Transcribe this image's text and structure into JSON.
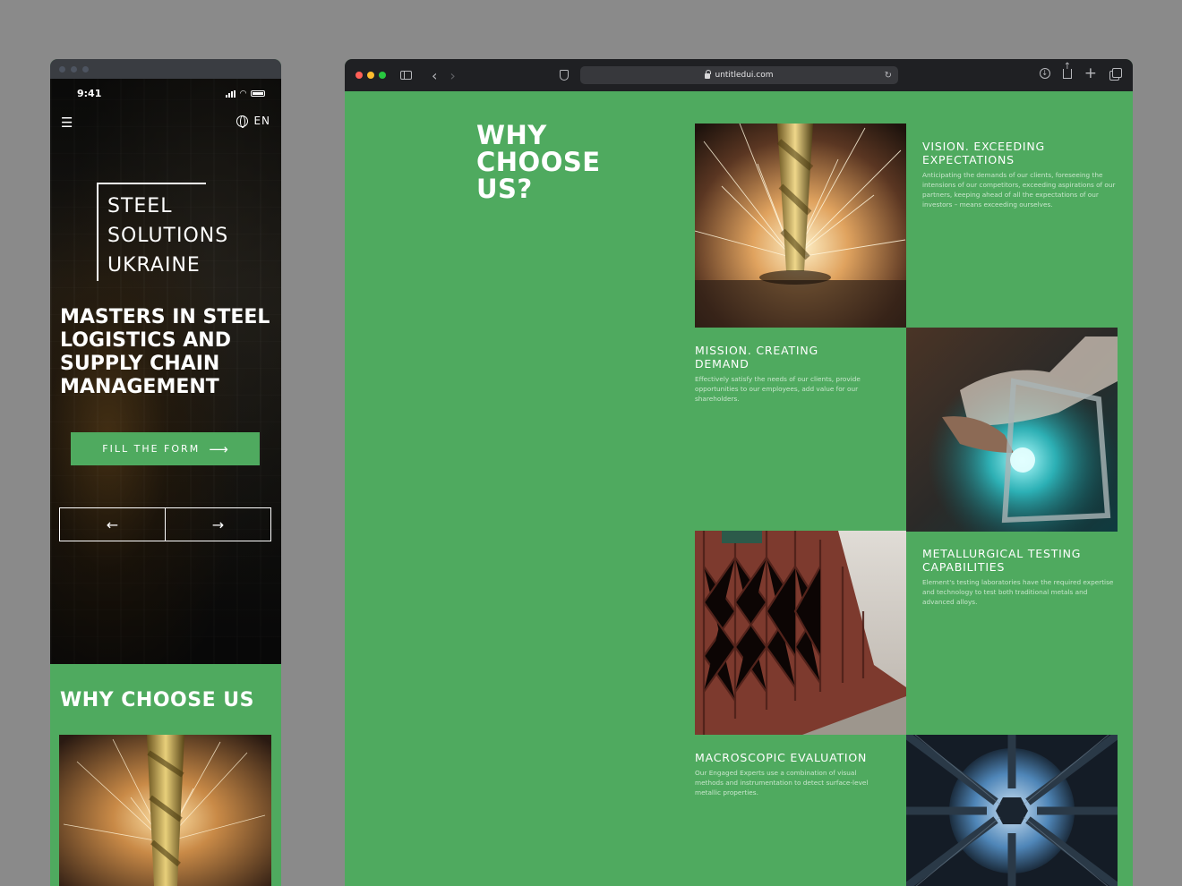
{
  "mobile": {
    "status": {
      "time": "9:41"
    },
    "lang": "EN",
    "logo_lines": [
      "STEEL",
      "SOLUTIONS",
      "UKRAINE"
    ],
    "headline": "MASTERS IN STEEL LOGISTICS AND SUPPLY CHAIN MANAGEMENT",
    "cta_label": "FILL THE FORM",
    "prev_arrow": "←",
    "next_arrow": "→",
    "section_title": "WHY CHOOSE US",
    "menu_icon": "☰"
  },
  "browser": {
    "url": "untitledui.com",
    "traffic_colors": [
      "#ff5f57",
      "#febc2e",
      "#28c840"
    ],
    "section_title": "WHY CHOOSE US?",
    "tiles": [
      {
        "title": "VISION. EXCEEDING EXPECTATIONS",
        "text": "Anticipating the demands of our clients, foreseeing the intensions of our competitors, exceeding aspirations of our partners, keeping ahead of all the expectations of our investors – means exceeding ourselves."
      },
      {
        "title": "MISSION. CREATING DEMAND",
        "text": "Effectively satisfy the needs of our clients, provide opportunities to our employees, add value for our shareholders."
      },
      {
        "title": "METALLURGICAL TESTING CAPABILITIES",
        "text": "Element's testing laboratories have the required expertise and technology to test both traditional metals and advanced alloys."
      },
      {
        "title": "MACROSCOPIC EVALUATION",
        "text": "Our Engaged Experts use a combination of visual methods and instrumentation to detect surface-level metallic properties."
      }
    ]
  },
  "colors": {
    "accent": "#4faa5f",
    "toolbar": "#1f2023"
  }
}
